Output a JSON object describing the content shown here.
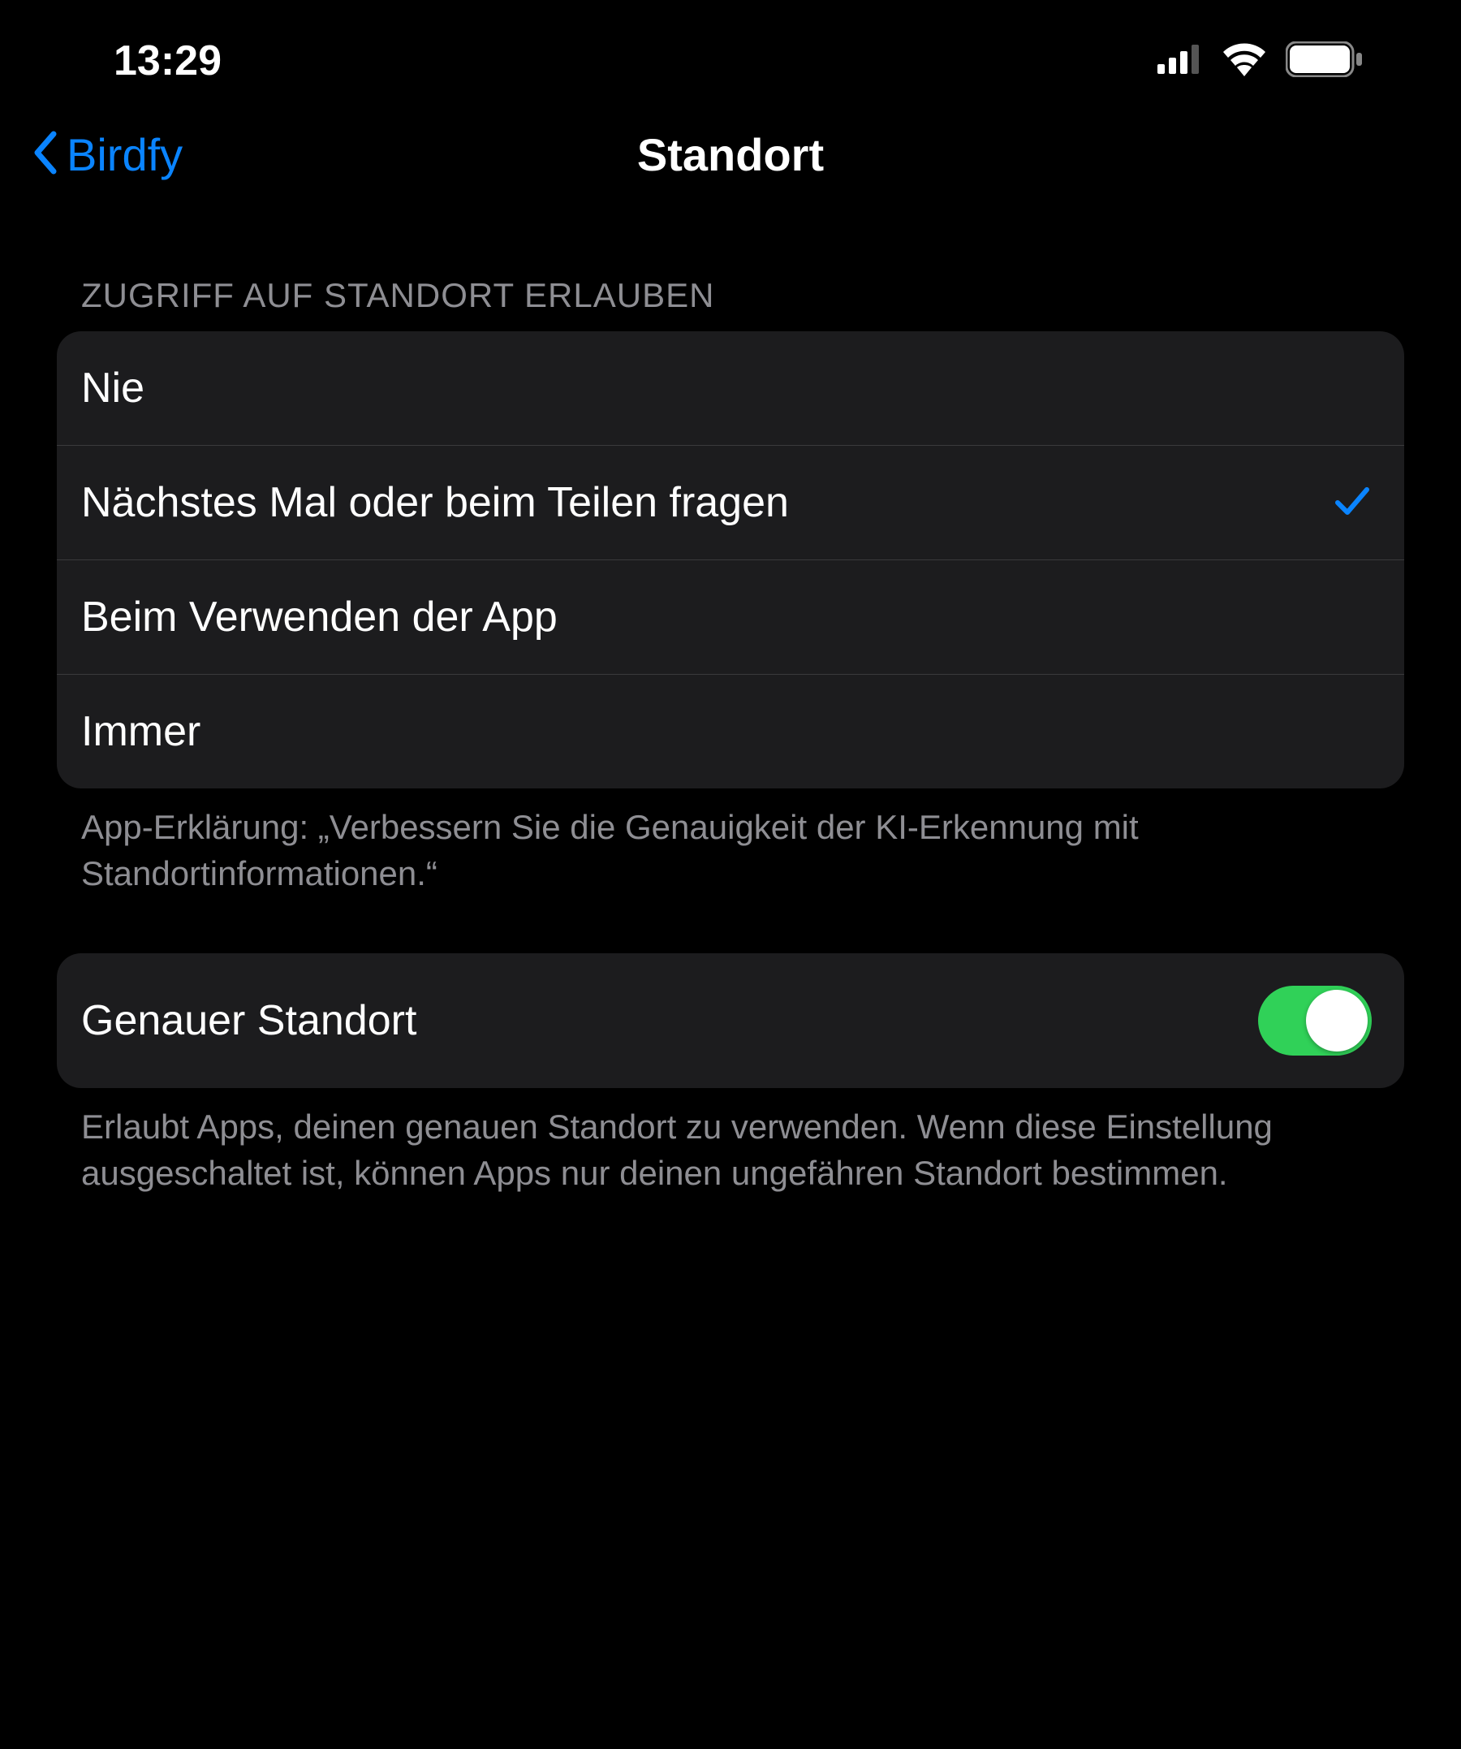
{
  "statusBar": {
    "time": "13:29"
  },
  "nav": {
    "back_label": "Birdfy",
    "title": "Standort"
  },
  "sections": {
    "access": {
      "header": "ZUGRIFF AUF STANDORT ERLAUBEN",
      "options": [
        {
          "label": "Nie",
          "selected": false
        },
        {
          "label": "Nächstes Mal oder beim Teilen fragen",
          "selected": true
        },
        {
          "label": "Beim Verwenden der App",
          "selected": false
        },
        {
          "label": "Immer",
          "selected": false
        }
      ],
      "footer": "App-Erklärung: „Verbessern Sie die Genauigkeit der KI-Erkennung mit Standortinformationen.“"
    },
    "precise": {
      "label": "Genauer Standort",
      "enabled": true,
      "footer": "Erlaubt Apps, deinen genauen Standort zu verwenden. Wenn diese Einstellung ausgeschaltet ist, können Apps nur deinen ungefähren Standort bestimmen."
    }
  },
  "colors": {
    "accent": "#0a84ff",
    "toggleOn": "#30d158"
  }
}
